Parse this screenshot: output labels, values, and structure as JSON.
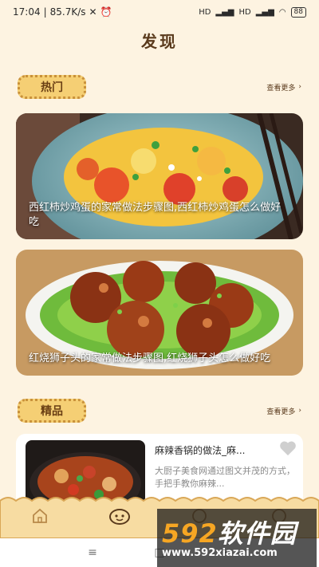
{
  "status_bar": {
    "time": "17:04",
    "speed": "85.7K/s",
    "network": "HD",
    "battery": "88",
    "icons": [
      "no-signal-icon",
      "alarm-icon",
      "signal-icon",
      "wifi-icon"
    ]
  },
  "page": {
    "title": "发现"
  },
  "hot_section": {
    "label": "热门",
    "more": "查看更多"
  },
  "hot_cards": [
    {
      "caption": "西红柿炒鸡蛋的家常做法步骤图,西红柿炒鸡蛋怎么做好吃"
    },
    {
      "caption": "红烧狮子头的家常做法步骤图,红烧狮子头怎么做好吃"
    }
  ],
  "featured_section": {
    "label": "精品",
    "more": "查看更多"
  },
  "featured_list": [
    {
      "title": "麻辣香锅的做法_麻...",
      "desc": "大厨子美食网通过图文并茂的方式，手把手教你麻辣..."
    }
  ],
  "tab_bar": {
    "items": [
      "home-icon",
      "discover-icon",
      "message-icon",
      "profile-icon"
    ],
    "active": 1
  },
  "watermark": {
    "logo_number": "592",
    "logo_text": "软件园",
    "url": "www.592xiazai.com"
  },
  "colors": {
    "background": "#fdf3e1",
    "badge": "#f5cf74",
    "accent": "#c9913a"
  }
}
